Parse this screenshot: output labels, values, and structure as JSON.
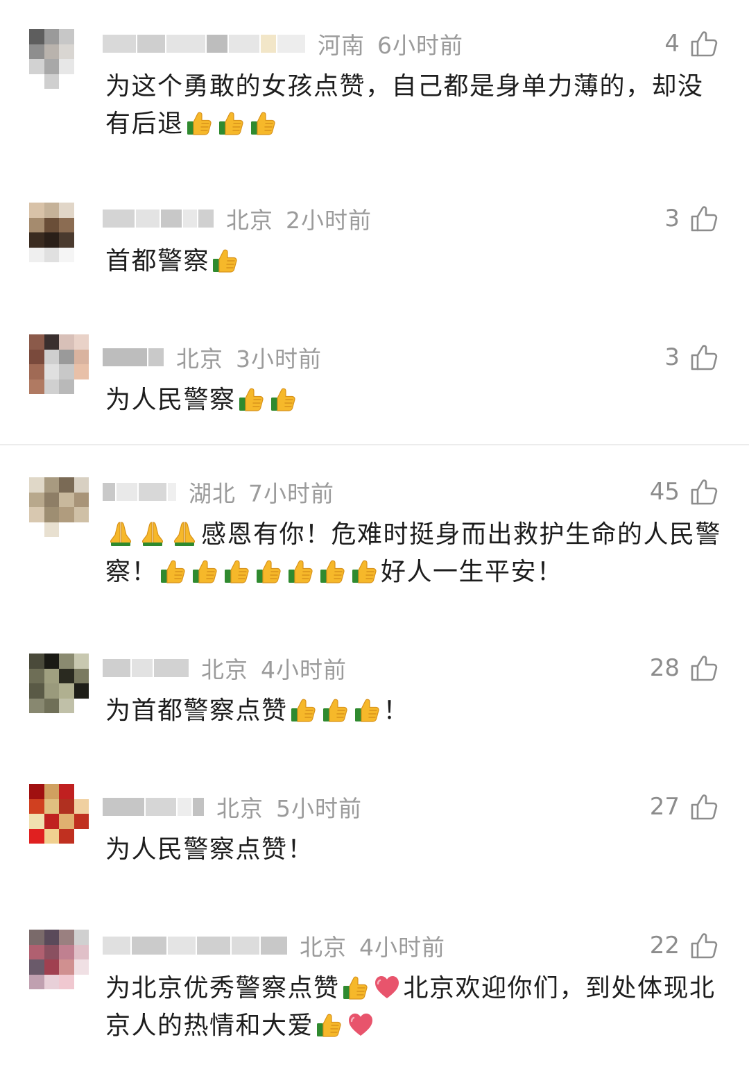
{
  "icons": {
    "like": "thumbs-up-outline-icon",
    "thumb_emoji": "thumbs-up-emoji",
    "pray_emoji": "folded-hands-emoji",
    "heart_emoji": "heart-emoji"
  },
  "colors": {
    "meta_gray": "#9b9b9b",
    "text_dark": "#1d1d1d",
    "thumb_yellow": "#f6b82a",
    "thumb_cuff": "#2f8a2f",
    "heart_pink": "#e8546c"
  },
  "comments": [
    {
      "location": "河南",
      "time": "6小时前",
      "likes": "4",
      "text_parts": [
        {
          "t": "为这个勇敢的女孩点赞，自己都是身单力薄的，却没有后退"
        },
        {
          "e": "thumb"
        },
        {
          "e": "thumb"
        },
        {
          "e": "thumb"
        }
      ]
    },
    {
      "location": "北京",
      "time": "2小时前",
      "likes": "3",
      "text_parts": [
        {
          "t": "首都警察"
        },
        {
          "e": "thumb"
        }
      ]
    },
    {
      "location": "北京",
      "time": "3小时前",
      "likes": "3",
      "text_parts": [
        {
          "t": "为人民警察"
        },
        {
          "e": "thumb"
        },
        {
          "e": "thumb"
        }
      ]
    },
    {
      "location": "湖北",
      "time": "7小时前",
      "likes": "45",
      "text_parts": [
        {
          "e": "pray"
        },
        {
          "e": "pray"
        },
        {
          "e": "pray"
        },
        {
          "t": "感恩有你！危难时挺身而出救护生命的人民警察！"
        },
        {
          "e": "thumb"
        },
        {
          "e": "thumb"
        },
        {
          "e": "thumb"
        },
        {
          "e": "thumb"
        },
        {
          "e": "thumb"
        },
        {
          "e": "thumb"
        },
        {
          "e": "thumb"
        },
        {
          "t": "好人一生平安！"
        }
      ]
    },
    {
      "location": "北京",
      "time": "4小时前",
      "likes": "28",
      "text_parts": [
        {
          "t": "为首都警察点赞"
        },
        {
          "e": "thumb"
        },
        {
          "e": "thumb"
        },
        {
          "e": "thumb"
        },
        {
          "t": "！"
        }
      ]
    },
    {
      "location": "北京",
      "time": "5小时前",
      "likes": "27",
      "text_parts": [
        {
          "t": "为人民警察点赞！"
        }
      ]
    },
    {
      "location": "北京",
      "time": "4小时前",
      "likes": "22",
      "text_parts": [
        {
          "t": "为北京优秀警察点赞"
        },
        {
          "e": "thumb"
        },
        {
          "e": "heart"
        },
        {
          "t": "北京欢迎你们，到处体现北京人的热情和大爱"
        },
        {
          "e": "thumb"
        },
        {
          "e": "heart"
        }
      ]
    }
  ]
}
